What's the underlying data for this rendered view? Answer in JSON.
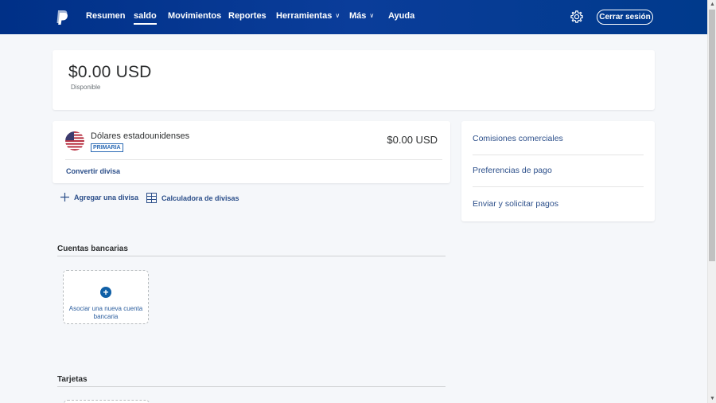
{
  "nav": {
    "items": [
      {
        "label": "Resumen",
        "active": false,
        "dropdown": false
      },
      {
        "label": "saldo",
        "active": true,
        "dropdown": false
      },
      {
        "label": "Movimientos",
        "active": false,
        "dropdown": false
      },
      {
        "label": "Reportes",
        "active": false,
        "dropdown": false
      },
      {
        "label": "Herramientas",
        "active": false,
        "dropdown": true
      },
      {
        "label": "Más",
        "active": false,
        "dropdown": true
      },
      {
        "label": "Ayuda",
        "active": false,
        "dropdown": false
      }
    ],
    "logout_label": "Cerrar sesión"
  },
  "balance": {
    "amount": "$0.00 USD",
    "label": "Disponible"
  },
  "currency": {
    "name": "Dólares estadounidenses",
    "badge": "PRIMARIA",
    "amount": "$0.00 USD",
    "convert_label": "Convertir divisa"
  },
  "actions": {
    "add_currency": "Agregar una divisa",
    "calculator": "Calculadora de divisas"
  },
  "side_links": [
    "Comisiones comerciales",
    "Preferencias de pago",
    "Enviar y solicitar pagos"
  ],
  "sections": {
    "bank_accounts": "Cuentas bancarias",
    "add_bank_label": "Asociar una nueva cuenta bancaria",
    "cards": "Tarjetas"
  },
  "colors": {
    "nav_bg": "#003087",
    "link": "#2c4f8a",
    "accent": "#0f5fa6"
  }
}
